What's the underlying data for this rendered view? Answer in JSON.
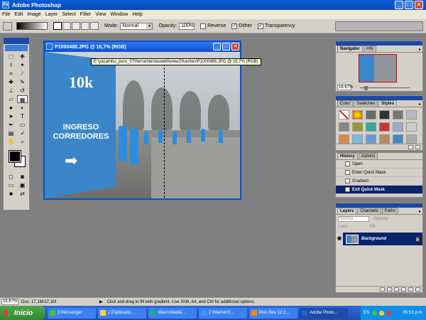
{
  "app": {
    "title": "Adobe Photoshop"
  },
  "menu": [
    "File",
    "Edit",
    "Image",
    "Layer",
    "Select",
    "Filter",
    "View",
    "Window",
    "Help"
  ],
  "options": {
    "mode_label": "Mode:",
    "mode_value": "Normal",
    "opacity_label": "Opacity:",
    "opacity_value": "100%",
    "reverse_label": "Reverse",
    "dither_label": "Dither",
    "transparency_label": "Transparency"
  },
  "document": {
    "title": "P1000488.JPG @ 16,7% (RGB)",
    "tooltip": "E:\\yacambu_peru_07\\herramientasweb\\www2\\fuentes\\P1000488.JPG @ 16,7% (RGB)",
    "banner_logo": "10k",
    "banner_text": "INGRESO CORREDORES"
  },
  "navigator": {
    "tabs": [
      "Navigator",
      "Info"
    ],
    "zoom": "16,67%"
  },
  "styles_palette": {
    "tabs": [
      "Color",
      "Swatches",
      "Styles"
    ]
  },
  "history": {
    "tabs": [
      "History",
      "Actions"
    ],
    "items": [
      "Open",
      "Enter Quick Mask",
      "Gradient",
      "Exit Quick Mask"
    ]
  },
  "layers": {
    "tabs": [
      "Layers",
      "Channels",
      "Paths"
    ],
    "blend_mode": "Normal",
    "opacity_label": "Opacity:",
    "fill_label": "Fill:",
    "lock_label": "Lock:",
    "layer_name": "Background"
  },
  "status": {
    "zoom": "16,67%",
    "doc": "Doc: 17,1M/17,1M",
    "hint": "Click and drag to fill with gradient.  Use Shift, Alt, and Ctrl for additional options."
  },
  "taskbar": {
    "start_label": "Inicio",
    "tasks": [
      "3 Messenger",
      "2 Explorado...",
      "Macromedia ...",
      "2 Internet E...",
      "Mon Nov 12 2...",
      "Adobe Photo..."
    ],
    "lang": "ES",
    "clock": "05:53 p.m."
  }
}
